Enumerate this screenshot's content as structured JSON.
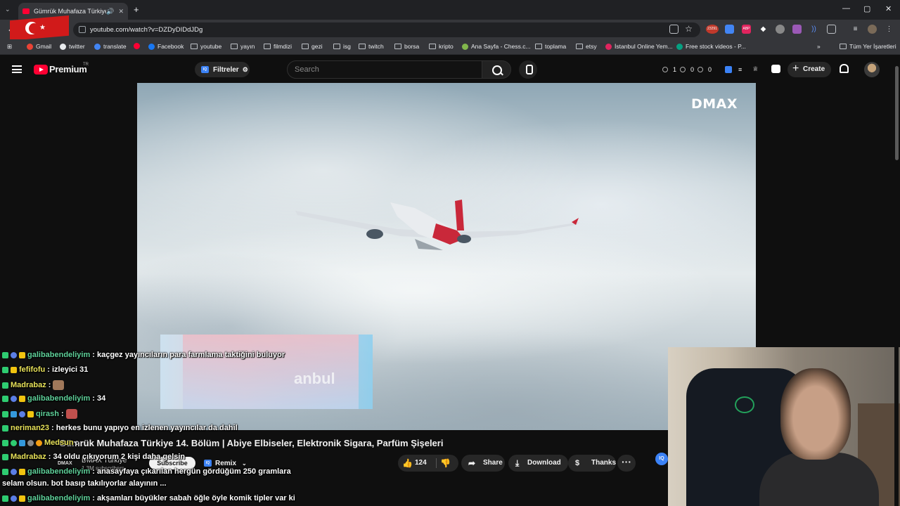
{
  "browser": {
    "tab_title": "Gümrük Muhafaza Türkiye",
    "new_tab": "+",
    "window_controls": [
      "—",
      "▢",
      "✕"
    ],
    "url": "youtube.com/watch?v=DZDyDIDdJDg",
    "badge_count": "23291",
    "bookmarks": [
      "Gmail",
      "twitter",
      "translate",
      "Facebook",
      "youtube",
      "yayın",
      "filmdizi",
      "gezi",
      "isg",
      "twitch",
      "borsa",
      "kripto",
      "Ana Sayfa - Chess.c...",
      "toplama",
      "etsy",
      "İstanbul Online Yem...",
      "Free stock videos - P..."
    ],
    "all_bookmarks": "Tüm Yer İşaretleri"
  },
  "youtube": {
    "logo_text": "Premium",
    "region": "TR",
    "filters_label": "Filtreler",
    "search_placeholder": "Search",
    "stats": [
      "1",
      "0",
      "0"
    ],
    "create_label": "Create"
  },
  "video": {
    "watermark": "DMAX",
    "overlay_text": "anbul",
    "title": "Gümrük Muhafaza Türkiye 14. Bölüm | Abiye Elbiseler, Elektronik Sigara, Parfüm Şişeleri",
    "channel": "DMAX Türkiye",
    "subscribers": "1,3M subscribers",
    "subscribe_label": "Subscribe",
    "remix_label": "Remix",
    "likes": "124",
    "share_label": "Share",
    "download_label": "Download",
    "thanks_label": "Thanks",
    "iq_label": "IQ"
  },
  "chat": [
    {
      "user": "galibabendeliyim",
      "message": ": kaçgez yayıncıların para farmlama taktiğini buluyor"
    },
    {
      "user": "fefifofu",
      "message": ": izleyici 31"
    },
    {
      "user": "Madrabaz",
      "message": ":"
    },
    {
      "user": "galibabendeliyim",
      "message": ": 34"
    },
    {
      "user": "qirash",
      "message": ":"
    },
    {
      "user": "neriman23",
      "message": ": herkes bunu yapıyo en izlenen yayıncılar da dahil"
    },
    {
      "user": "Medsun",
      "message": ":"
    },
    {
      "user": "Madrabaz",
      "message": ": 34 oldu çıkıyorum 2 kişi daha gelsin"
    },
    {
      "user": "galibabendeliyim",
      "message": ": anasayfaya çıkarılan hergün gördüğüm 250 gramlara"
    },
    {
      "user": "",
      "message": "selam olsun. bot basıp takılıyorlar alayının ..."
    },
    {
      "user": "galibabendeliyim",
      "message": ": akşamları büyükler sabah öğle öyle komik tipler var ki"
    }
  ],
  "colors": {
    "accent": "#ff0033",
    "chat_user": "#5fd19a",
    "iq": "#3b82f6"
  }
}
